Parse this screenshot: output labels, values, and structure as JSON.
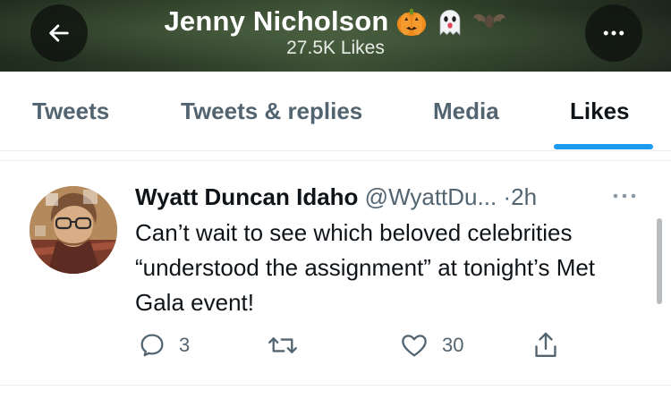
{
  "header": {
    "profile_name": "Jenny Nicholson",
    "name_emojis": [
      "pumpkin-icon",
      "ghost-icon",
      "bat-icon"
    ],
    "likes_count_label": "27.5K Likes",
    "back_icon": "arrow-left-icon",
    "more_icon": "more-horizontal-icon"
  },
  "tabs": [
    {
      "label": "Tweets",
      "active": false
    },
    {
      "label": "Tweets & replies",
      "active": false
    },
    {
      "label": "Media",
      "active": false
    },
    {
      "label": "Likes",
      "active": true
    }
  ],
  "tweet": {
    "author_name": "Wyatt Duncan Idaho",
    "handle": "@WyattDu...",
    "separator": "·",
    "time": "2h",
    "text": "Can’t wait to see which beloved celebrities “understood the assignment” at tonight’s Met Gala event!",
    "reply_count": "3",
    "retweet_count": "",
    "like_count": "30"
  },
  "colors": {
    "accent": "#1d9bf0",
    "secondary_text": "#536471",
    "primary_text": "#0f1419"
  }
}
